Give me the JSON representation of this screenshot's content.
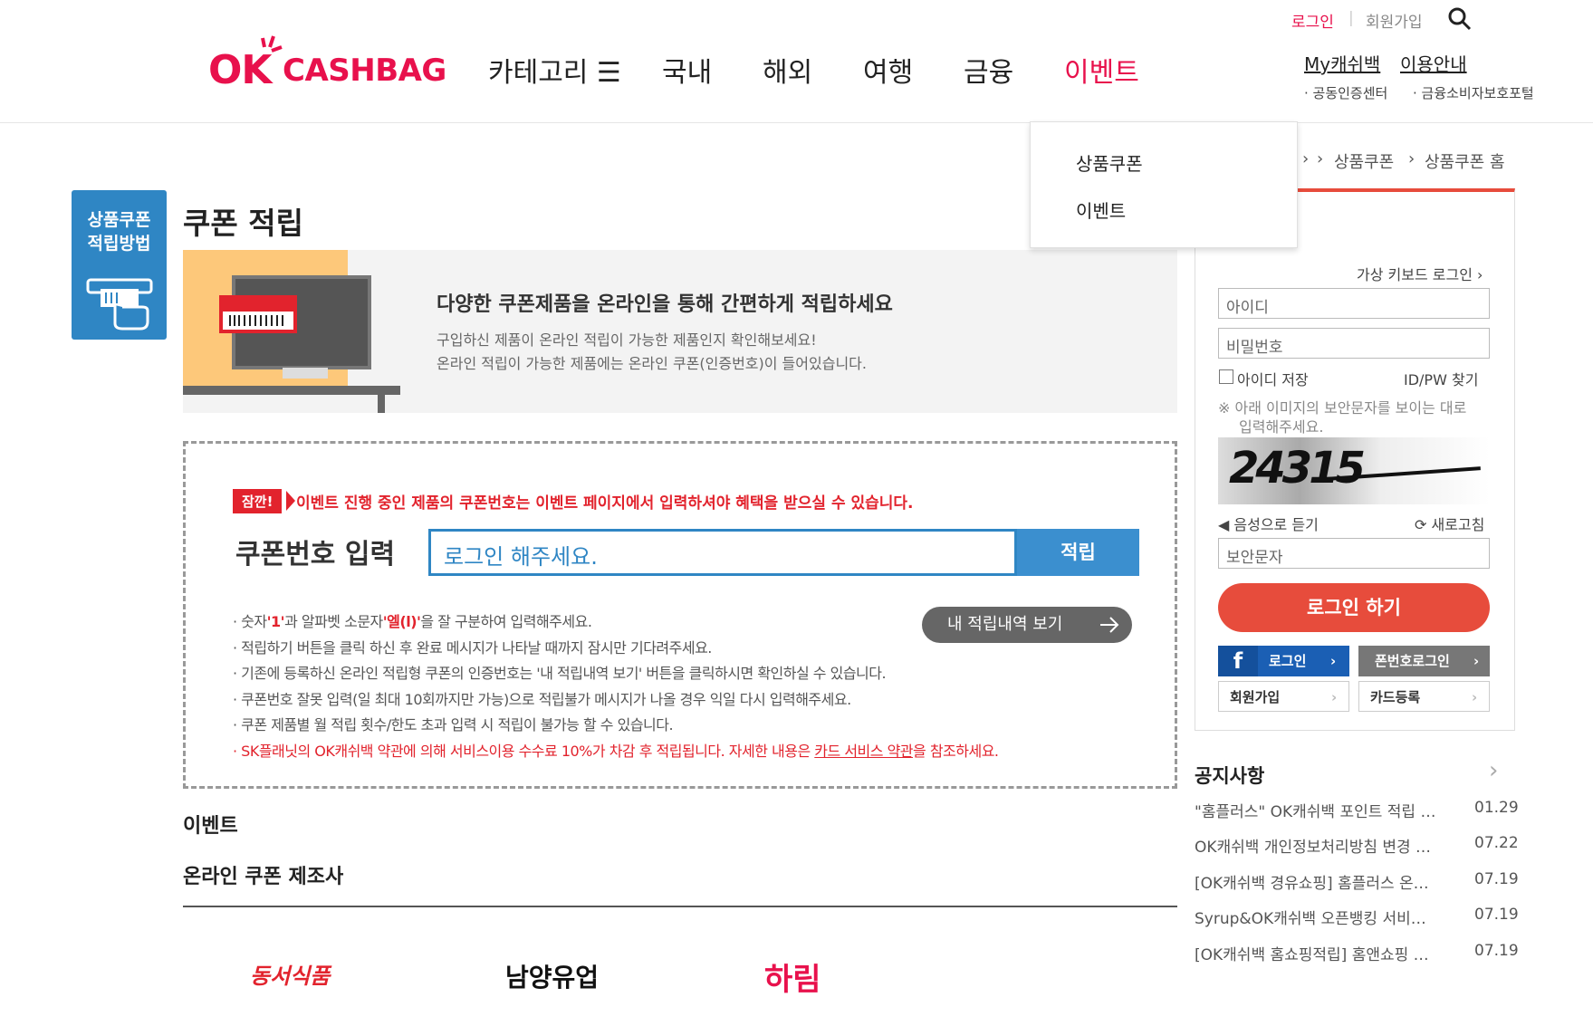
{
  "header": {
    "logo_ok": "OK",
    "logo_cashbag": "CASHBAG",
    "nav": [
      "카테고리 ☰",
      "국내",
      "해외",
      "여행",
      "금융",
      "이벤트"
    ],
    "login": "로그인",
    "signup": "회원가입",
    "my_cashbag": "My캐쉬백",
    "guide": "이용안내",
    "cert_center": "· 공동인증센터",
    "consumer_portal": "· 금융소비자보호포털"
  },
  "dropdown": {
    "items": [
      "상품쿠폰",
      "이벤트"
    ]
  },
  "side_tab": {
    "line1": "상품쿠폰",
    "line2": "적립방법"
  },
  "breadcrumb": {
    "item1": "상품쿠폰",
    "item2": "상품쿠폰 홈"
  },
  "page": {
    "title": "쿠폰 적립",
    "banner_heading": "다양한 쿠폰제품을 온라인을 통해 간편하게 적립하세요",
    "banner_line1": "구입하신 제품이 온라인 적립이 가능한 제품인지 확인해보세요!",
    "banner_line2": "온라인 적립이 가능한 제품에는 온라인 쿠폰(인증번호)이 들어있습니다."
  },
  "coupon": {
    "badge": "잠깐!",
    "notice": "이벤트 진행 중인 제품의 쿠폰번호는 이벤트 페이지에서 입력하셔야 혜택을 받으실 수 있습니다.",
    "label": "쿠폰번호 입력",
    "input_value": "로그인 해주세요.",
    "submit": "적립",
    "history_button": "내 적립내역 보기",
    "guide1_a": "숫자",
    "guide1_b": "'1'",
    "guide1_c": "과 알파벳 소문자",
    "guide1_d": "'엘(l)'",
    "guide1_e": "을 잘 구분하여 입력해주세요.",
    "guide2": "적립하기 버튼을 클릭 하신 후 완료 메시지가 나타날 때까지 잠시만 기다려주세요.",
    "guide3": "기존에 등록하신 온라인 적립형 쿠폰의 인증번호는 '내 적립내역 보기' 버튼을 클릭하시면 확인하실 수 있습니다.",
    "guide4": "쿠폰번호 잘못 입력(일 최대 10회까지만 가능)으로 적립불가 메시지가 나올 경우 익일 다시 입력해주세요.",
    "guide5": "쿠폰 제품별 월 적립 횟수/한도 초과 입력 시 적립이 불가능 할 수 있습니다.",
    "guide6_a": "SK플래닛의 OK캐쉬백 약관에 의해 서비스이용 수수료 10%가 차감 후 적립됩니다. 자세한 내용은 ",
    "guide6_link": "카드 서비스 약관",
    "guide6_b": "을 참조하세요."
  },
  "sections": {
    "event": "이벤트",
    "makers": "온라인 쿠폰 제조사"
  },
  "makers": [
    "동서식품",
    "남양유업",
    "하림"
  ],
  "maker_colors": [
    "#e2232d",
    "#111111",
    "#e8114c"
  ],
  "login_box": {
    "virtual_keyboard": "가상 키보드 로그인 ›",
    "id_placeholder": "아이디",
    "pw_placeholder": "비밀번호",
    "save_id": "아이디 저장",
    "find_idpw": "ID/PW 찾기",
    "captcha_note1": "※ 아래 이미지의 보안문자를 보이는 대로",
    "captcha_note2": "입력해주세요.",
    "captcha_text": "24315",
    "audio": "◀ 음성으로 듣기",
    "refresh": "⟳ 새로고침",
    "captcha_placeholder": "보안문자",
    "login_button": "로그인 하기",
    "fb_login": "로그인",
    "phone_login": "폰번호로그인",
    "join": "회원가입",
    "card_register": "카드등록"
  },
  "notices": {
    "title": "공지사항",
    "items": [
      {
        "title": "\"홈플러스\" OK캐쉬백 포인트 적립 …",
        "date": "01.29"
      },
      {
        "title": "OK캐쉬백 개인정보처리방침 변경 …",
        "date": "07.22"
      },
      {
        "title": "[OK캐쉬백 경유쇼핑] 홈플러스 온…",
        "date": "07.19"
      },
      {
        "title": "Syrup&OK캐쉬백 오픈뱅킹 서비…",
        "date": "07.19"
      },
      {
        "title": "[OK캐쉬백 홈쇼핑적립] 홈앤쇼핑 …",
        "date": "07.19"
      }
    ]
  },
  "colors": {
    "brand": "#e8114c",
    "blue": "#2f86c4",
    "login_red": "#e74c3c",
    "facebook": "#1b5fb4"
  }
}
